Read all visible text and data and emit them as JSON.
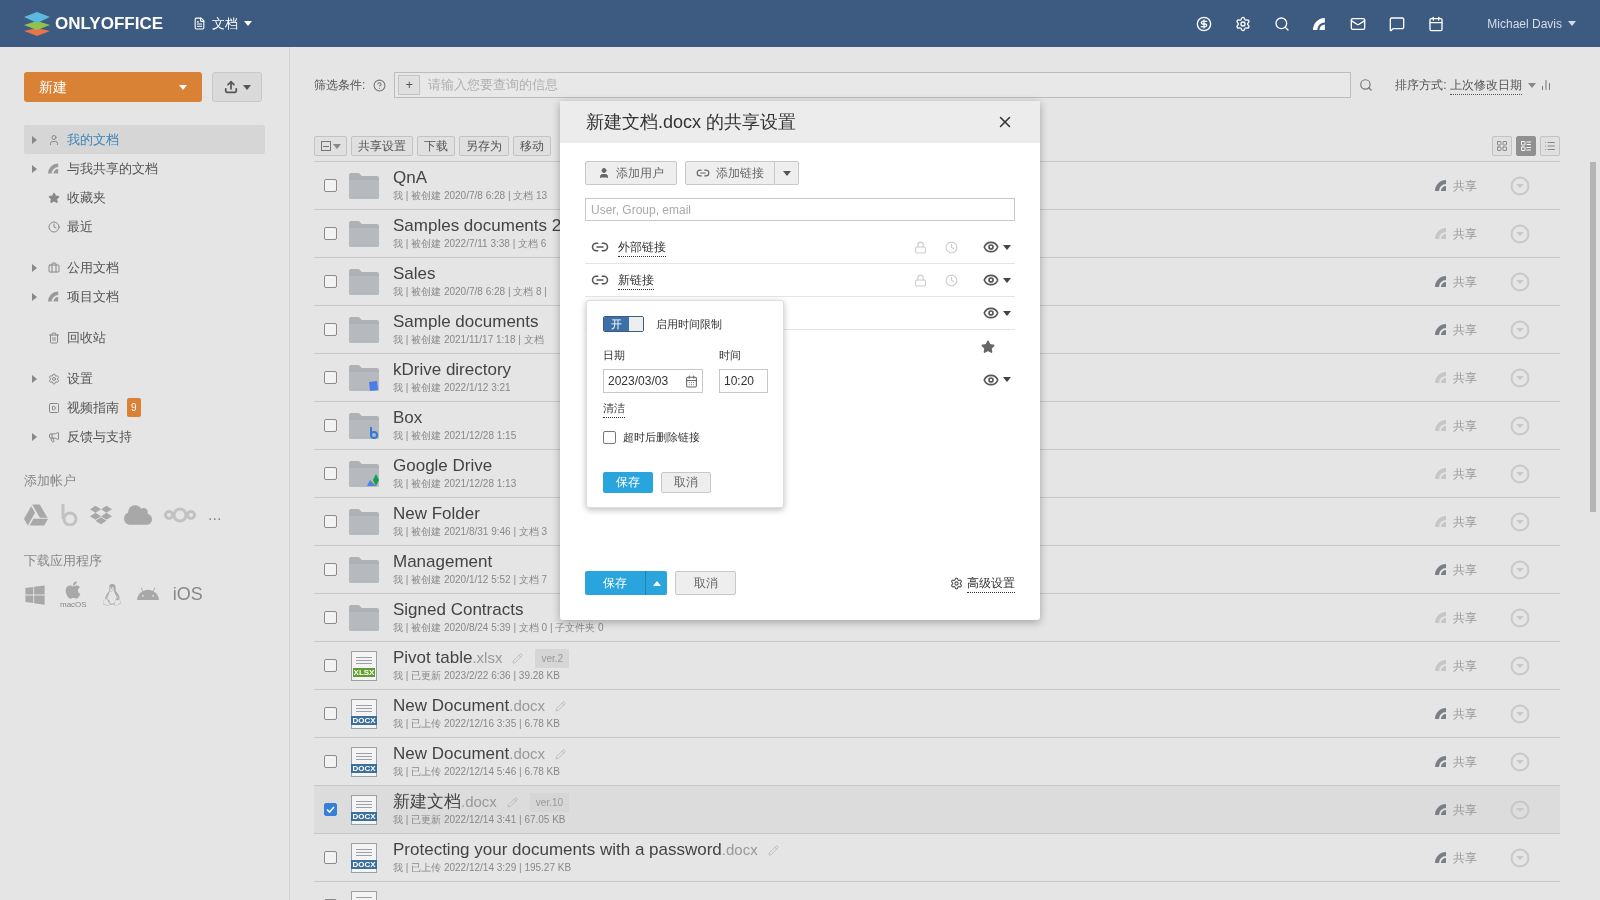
{
  "header": {
    "logo": "ONLYOFFICE",
    "module": "文档",
    "user": "Michael Davis"
  },
  "sidebar": {
    "new_button": "新建",
    "groups": [
      {
        "items": [
          {
            "label": "我的文档",
            "selected": true,
            "expandable": true
          },
          {
            "label": "与我共享的文档",
            "selected": false,
            "expandable": true
          },
          {
            "label": "收藏夹",
            "selected": false,
            "expandable": false
          },
          {
            "label": "最近",
            "selected": false,
            "expandable": false
          }
        ]
      },
      {
        "items": [
          {
            "label": "公用文档",
            "selected": false,
            "expandable": true
          },
          {
            "label": "项目文档",
            "selected": false,
            "expandable": true
          }
        ]
      },
      {
        "items": [
          {
            "label": "回收站",
            "selected": false,
            "expandable": false
          }
        ]
      },
      {
        "items": [
          {
            "label": "设置",
            "selected": false,
            "expandable": true
          },
          {
            "label": "视频指南",
            "selected": false,
            "expandable": false,
            "badge": "9"
          },
          {
            "label": "反馈与支持",
            "selected": false,
            "expandable": true
          }
        ]
      }
    ],
    "add_account": {
      "title": "添加帐户",
      "more": "..."
    },
    "download_apps": {
      "title": "下载应用程序",
      "mac_label": "macOS",
      "ios": "iOS"
    }
  },
  "filter": {
    "label": "筛选条件:",
    "plus": "+",
    "placeholder": "请输入您要查询的信息"
  },
  "sort": {
    "label": "排序方式:",
    "value": "上次修改日期"
  },
  "toolbar": [
    "共享设置",
    "下载",
    "另存为",
    "移动"
  ],
  "view_modes": [
    {
      "kind": "tiles",
      "selected": false
    },
    {
      "kind": "compact",
      "selected": true
    },
    {
      "kind": "list",
      "selected": false
    }
  ],
  "files": [
    {
      "kind": "folder",
      "name": "QnA",
      "meta": "我 | 被创建 2020/7/8 6:28 | 文档 13",
      "checked": false,
      "shared": true,
      "share_label": "共享"
    },
    {
      "kind": "folder",
      "name": "Samples documents 2",
      "meta": "我 | 被创建 2022/7/11 3:38 | 文档 6",
      "checked": false,
      "shared": false,
      "share_label": "共享"
    },
    {
      "kind": "folder",
      "name": "Sales",
      "meta": "我 | 被创建 2020/7/8 6:28 | 文档 8 |",
      "checked": false,
      "shared": true,
      "share_label": "共享"
    },
    {
      "kind": "folder",
      "name": "Sample documents",
      "meta": "我 | 被创建 2021/11/17 1:18 | 文档",
      "checked": false,
      "shared": true,
      "share_label": "共享"
    },
    {
      "kind": "kdrive-folder",
      "name": "kDrive directory",
      "meta": "我 | 被创建 2022/1/12 3:21",
      "checked": false,
      "shared": false,
      "share_label": "共享"
    },
    {
      "kind": "box-folder",
      "name": "Box",
      "meta": "我 | 被创建 2021/12/28 1:15",
      "checked": false,
      "shared": false,
      "share_label": "共享"
    },
    {
      "kind": "gdrive-folder",
      "name": "Google Drive",
      "meta": "我 | 被创建 2021/12/28 1:13",
      "checked": false,
      "shared": false,
      "share_label": "共享"
    },
    {
      "kind": "folder",
      "name": "New Folder",
      "meta": "我 | 被创建 2021/8/31 9:46 | 文档 3",
      "checked": false,
      "shared": false,
      "share_label": "共享"
    },
    {
      "kind": "folder",
      "name": "Management",
      "meta": "我 | 被创建 2020/1/12 5:52 | 文档 7",
      "checked": false,
      "shared": true,
      "share_label": "共享"
    },
    {
      "kind": "folder",
      "name": "Signed Contracts",
      "meta": "我 | 被创建 2020/8/24 5:39 | 文档 0 | 子文件夹 0",
      "checked": false,
      "shared": false,
      "share_label": "共享"
    },
    {
      "kind": "sheet",
      "icon_label": "XLSX",
      "name": "Pivot table",
      "ext": ".xlsx",
      "version": "ver.2",
      "meta": "我 | 已更新 2023/2/22 6:36 | 39.28 KB",
      "checked": false,
      "shared": false,
      "share_label": "共享"
    },
    {
      "kind": "doc",
      "icon_label": "DOCX",
      "name": "New Document",
      "ext": ".docx",
      "meta": "我 | 已上传 2022/12/16 3:35 | 6.78 KB",
      "checked": false,
      "shared": true,
      "share_label": "共享"
    },
    {
      "kind": "doc",
      "icon_label": "DOCX",
      "name": "New Document",
      "ext": ".docx",
      "meta": "我 | 已上传 2022/12/14 5:46 | 6.78 KB",
      "checked": false,
      "shared": true,
      "share_label": "共享"
    },
    {
      "kind": "doc",
      "icon_label": "DOCX",
      "name": "新建文档",
      "ext": ".docx",
      "version": "ver.10",
      "meta": "我 | 已更新 2022/12/14 3:41 | 67.05 KB",
      "checked": true,
      "shared": true,
      "share_label": "共享"
    },
    {
      "kind": "doc",
      "icon_label": "DOCX",
      "name": "Protecting your documents with a password",
      "ext": ".docx",
      "meta": "我 | 已上传 2022/12/14 3:29 | 195.27 KB",
      "checked": false,
      "shared": true,
      "share_label": "共享"
    },
    {
      "kind": "template",
      "checked": false
    }
  ],
  "dialog": {
    "title": "新建文档.docx 的共享设置",
    "add_user": "添加用户",
    "add_link": "添加链接",
    "search_placeholder": "User, Group, email",
    "entries": [
      {
        "kind": "link",
        "name": "外部链接"
      },
      {
        "kind": "link",
        "name": "新链接"
      },
      {
        "kind": "access"
      },
      {
        "kind": "owner"
      },
      {
        "kind": "access"
      }
    ],
    "popup": {
      "toggle": {
        "on": true,
        "label": "开"
      },
      "toggle_caption": "启用时间限制",
      "date_label": "日期",
      "date": "2023/03/03",
      "time_label": "时间",
      "time": "10:20",
      "clear": "清洁",
      "delete_after": {
        "label": "超时后删除链接",
        "checked": false
      },
      "save": "保存",
      "cancel": "取消"
    },
    "save": "保存",
    "cancel": "取消",
    "advanced": "高级设置"
  }
}
